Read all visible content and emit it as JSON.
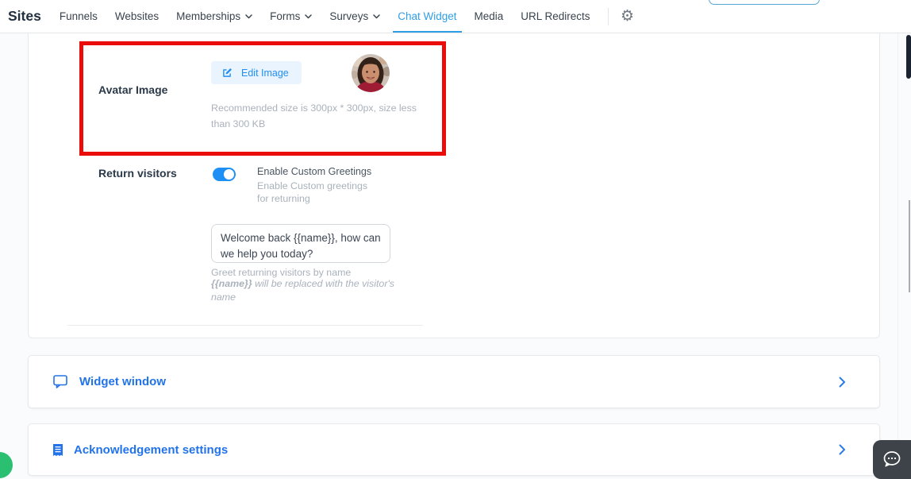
{
  "nav": {
    "title": "Sites",
    "tabs": [
      {
        "label": "Funnels"
      },
      {
        "label": "Websites"
      },
      {
        "label": "Memberships",
        "has_dropdown": true
      },
      {
        "label": "Forms",
        "has_dropdown": true
      },
      {
        "label": "Surveys",
        "has_dropdown": true
      },
      {
        "label": "Chat Widget",
        "active": true
      },
      {
        "label": "Media"
      },
      {
        "label": "URL Redirects"
      }
    ]
  },
  "panel": {
    "avatar_row": {
      "label": "Avatar Image",
      "edit_button_label": "Edit Image",
      "helper_text": "Recommended size is 300px * 300px, size less than 300 KB"
    },
    "return_visitors_row": {
      "label": "Return visitors",
      "toggle_state": "on",
      "option_title": "Enable Custom Greetings",
      "option_subtitle": "Enable Custom greetings for returning",
      "greeting_text": "Welcome back {{name}}, how can we help you today?",
      "helper_plain": "Greet returning visitors by name",
      "helper_token": "{{name}}",
      "helper_italic_rest": " will be replaced with the visitor's name"
    }
  },
  "section_cards": [
    {
      "title": "Widget window",
      "icon": "chat-bubble-icon"
    },
    {
      "title": "Acknowledgement settings",
      "icon": "receipt-icon"
    }
  ],
  "colors": {
    "tab_active_blue": "#2f9fe5",
    "accent_blue": "#1f8ef9",
    "card_title_blue": "#2273e9",
    "annotation_red": "#ea0b0b",
    "toggle_on_blue": "#1e90f5",
    "launcher_dark": "#3e4349",
    "presence_green": "#2abf71"
  }
}
